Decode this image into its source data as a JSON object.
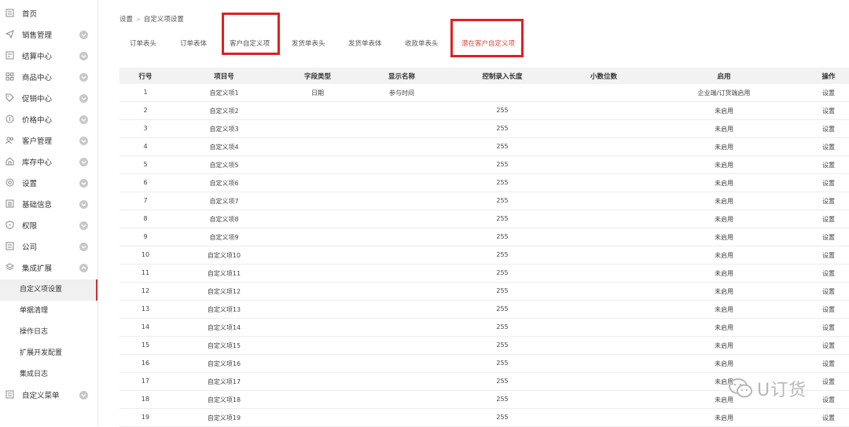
{
  "sidebar": {
    "items": [
      {
        "label": "首页",
        "icon": "home-icon"
      },
      {
        "label": "销售管理",
        "icon": "send-icon"
      },
      {
        "label": "结算中心",
        "icon": "settlement-icon"
      },
      {
        "label": "商品中心",
        "icon": "grid-icon"
      },
      {
        "label": "促销中心",
        "icon": "tag-icon"
      },
      {
        "label": "价格中心",
        "icon": "price-icon"
      },
      {
        "label": "客户管理",
        "icon": "customers-icon"
      },
      {
        "label": "库存中心",
        "icon": "warehouse-icon"
      },
      {
        "label": "设置",
        "icon": "gear-icon"
      },
      {
        "label": "基础信息",
        "icon": "info-icon"
      },
      {
        "label": "权限",
        "icon": "shield-icon"
      },
      {
        "label": "公司",
        "icon": "company-icon"
      },
      {
        "label": "集成扩展",
        "icon": "layers-icon"
      }
    ],
    "sub_items": [
      {
        "label": "自定义项设置",
        "active": true
      },
      {
        "label": "单据清理"
      },
      {
        "label": "操作日志"
      },
      {
        "label": "扩展开发配置"
      },
      {
        "label": "集成日志"
      }
    ],
    "bottom_item": {
      "label": "自定义菜单",
      "icon": "menu-icon"
    }
  },
  "breadcrumb": {
    "root": "设置",
    "current": "自定义项设置"
  },
  "tabs": [
    "订单表头",
    "订单表体",
    "客户自定义项",
    "发货单表头",
    "发货单表体",
    "收款单表头",
    "潜在客户自定义项"
  ],
  "table": {
    "headers": [
      "行号",
      "项目号",
      "字段类型",
      "显示名称",
      "控制录入长度",
      "小数位数",
      "启用",
      "操作"
    ],
    "rows": [
      [
        "1",
        "自定义项1",
        "日期",
        "参与时间",
        "",
        "",
        "企业端/订货端启用",
        "设置"
      ],
      [
        "2",
        "自定义项2",
        "",
        "",
        "255",
        "",
        "未启用",
        "设置"
      ],
      [
        "3",
        "自定义项3",
        "",
        "",
        "255",
        "",
        "未启用",
        "设置"
      ],
      [
        "4",
        "自定义项4",
        "",
        "",
        "255",
        "",
        "未启用",
        "设置"
      ],
      [
        "5",
        "自定义项5",
        "",
        "",
        "255",
        "",
        "未启用",
        "设置"
      ],
      [
        "6",
        "自定义项6",
        "",
        "",
        "255",
        "",
        "未启用",
        "设置"
      ],
      [
        "7",
        "自定义项7",
        "",
        "",
        "255",
        "",
        "未启用",
        "设置"
      ],
      [
        "8",
        "自定义项8",
        "",
        "",
        "255",
        "",
        "未启用",
        "设置"
      ],
      [
        "9",
        "自定义项9",
        "",
        "",
        "255",
        "",
        "未启用",
        "设置"
      ],
      [
        "10",
        "自定义项10",
        "",
        "",
        "255",
        "",
        "未启用",
        "设置"
      ],
      [
        "11",
        "自定义项11",
        "",
        "",
        "255",
        "",
        "未启用",
        "设置"
      ],
      [
        "12",
        "自定义项12",
        "",
        "",
        "255",
        "",
        "未启用",
        "设置"
      ],
      [
        "13",
        "自定义项13",
        "",
        "",
        "255",
        "",
        "未启用",
        "设置"
      ],
      [
        "14",
        "自定义项14",
        "",
        "",
        "255",
        "",
        "未启用",
        "设置"
      ],
      [
        "15",
        "自定义项15",
        "",
        "",
        "255",
        "",
        "未启用",
        "设置"
      ],
      [
        "16",
        "自定义项16",
        "",
        "",
        "255",
        "",
        "未启用",
        "设置"
      ],
      [
        "17",
        "自定义项17",
        "",
        "",
        "255",
        "",
        "未启用",
        "设置"
      ],
      [
        "18",
        "自定义项18",
        "",
        "",
        "255",
        "",
        "未启用",
        "设置"
      ],
      [
        "19",
        "自定义项19",
        "",
        "",
        "255",
        "",
        "未启用",
        "设置"
      ]
    ]
  },
  "watermark": {
    "text": "U订货"
  },
  "colors": {
    "highlight_box": "#e02020",
    "active_tab_text": "#d9463a",
    "active_indicator": "#c83232"
  }
}
